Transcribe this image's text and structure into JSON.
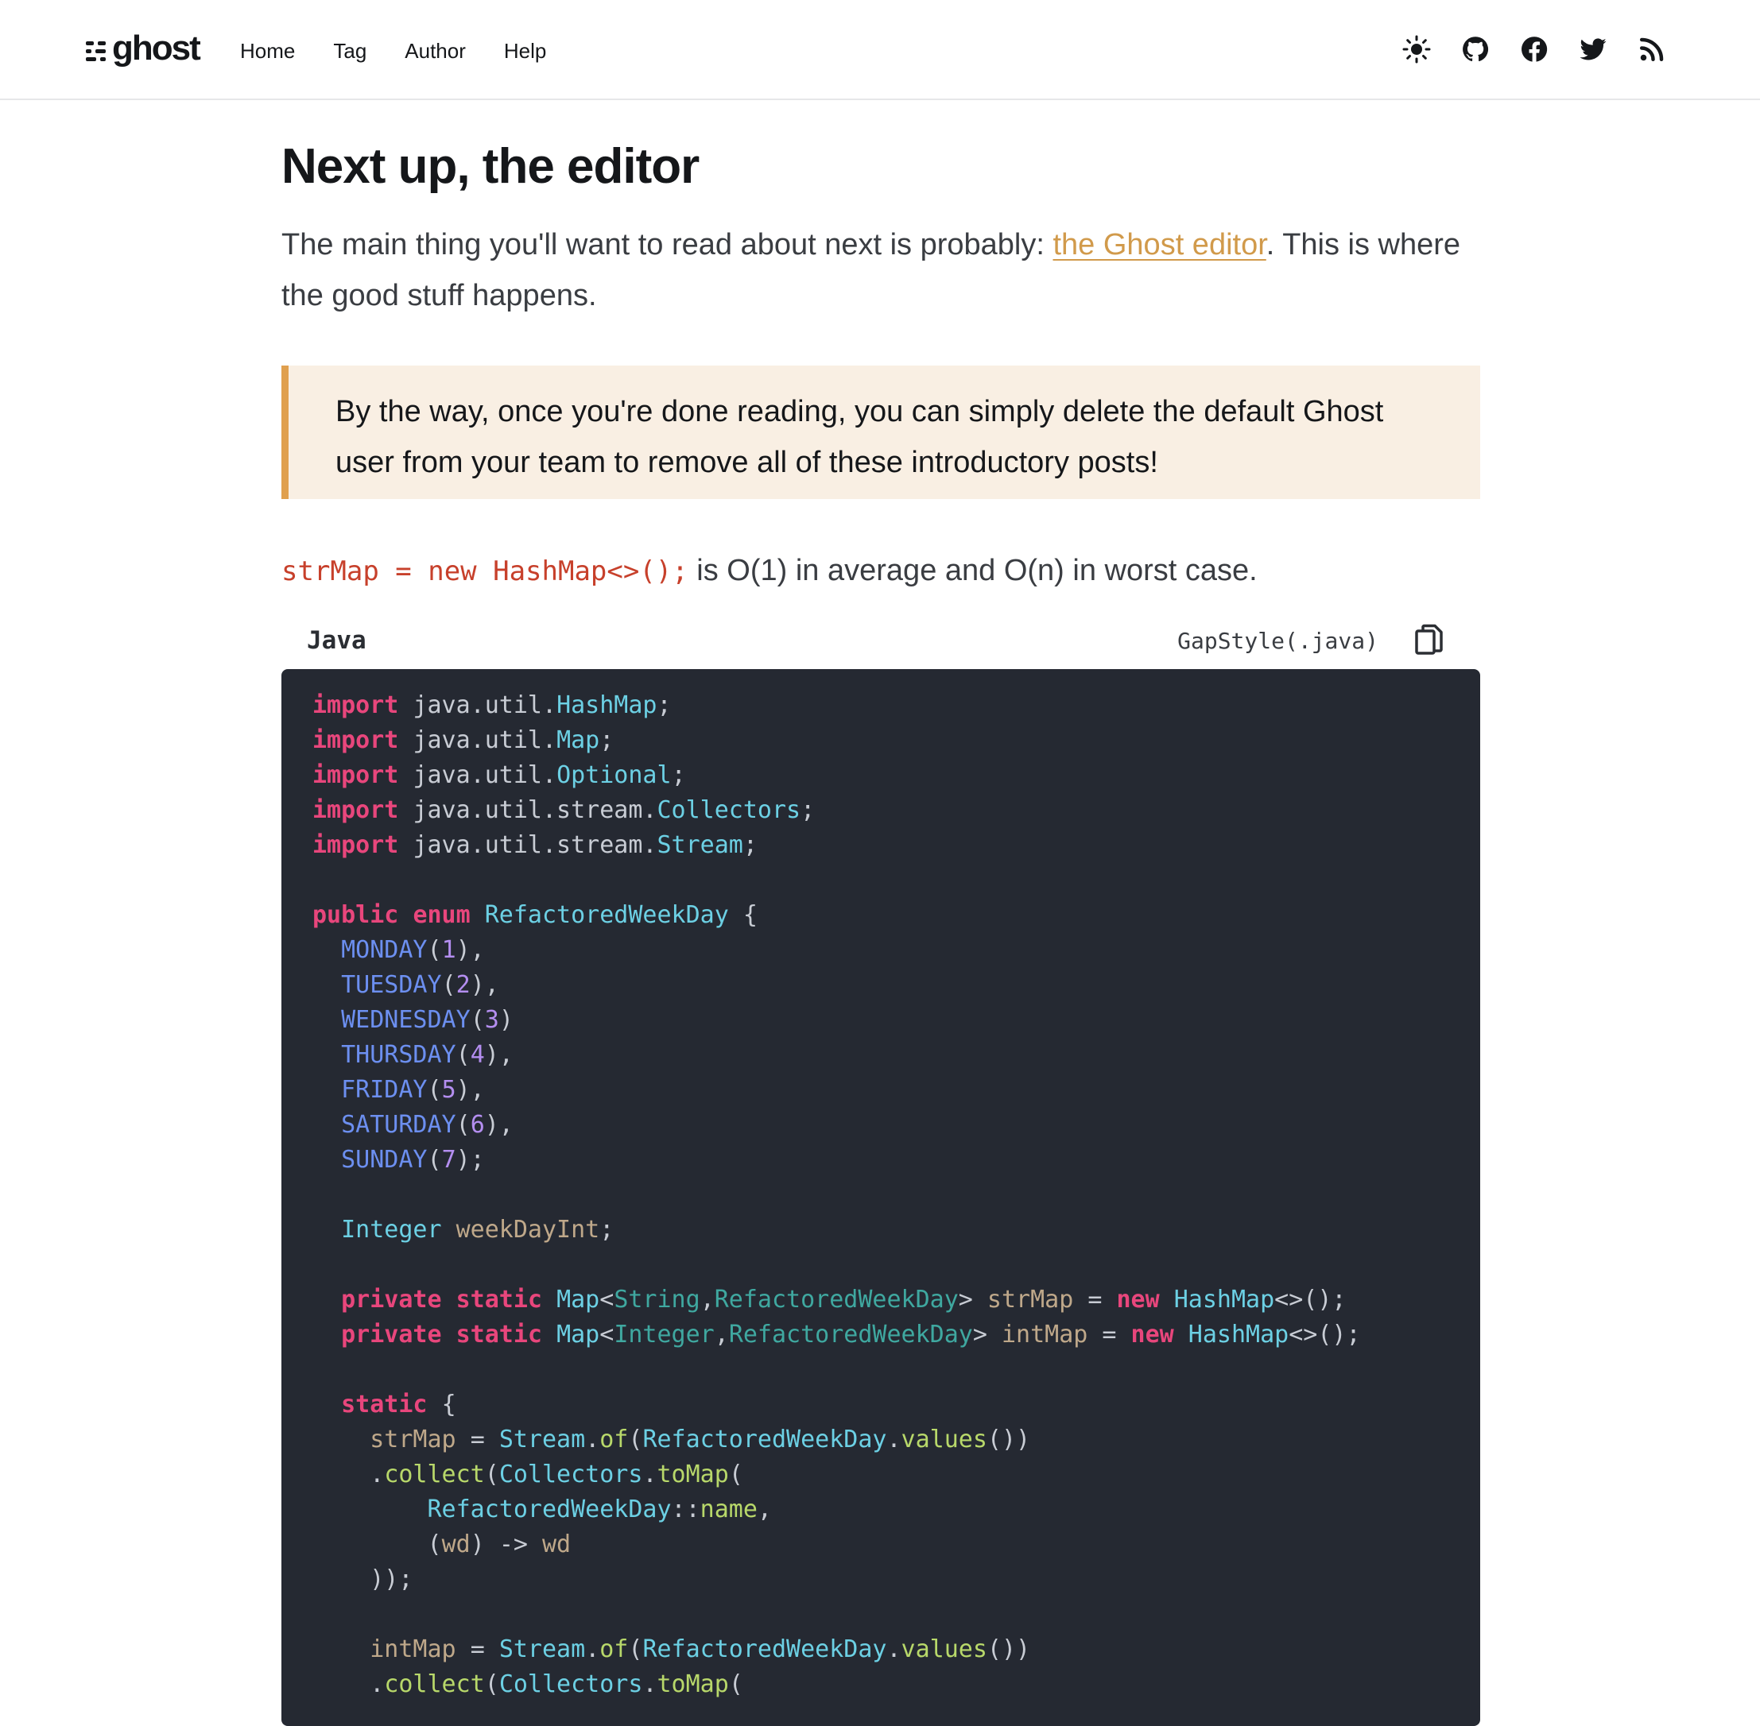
{
  "header": {
    "logo_text": "ghost",
    "nav": [
      "Home",
      "Tag",
      "Author",
      "Help"
    ],
    "icons": [
      "sun-icon",
      "github-icon",
      "facebook-icon",
      "twitter-icon",
      "rss-icon"
    ]
  },
  "article": {
    "heading": "Next up, the editor",
    "intro_before": "The main thing you'll want to read about next is probably: ",
    "intro_link": "the Ghost editor",
    "intro_after": ". This is where the good stuff happens.",
    "callout": "By the way, once you're done reading, you can simply delete the default Ghost user from your team to remove all of these introductory posts!",
    "inline_code": "strMap = new HashMap<>();",
    "inline_text": " is O(1) in average and O(n) in worst case."
  },
  "code": {
    "language": "Java",
    "filename": "GapStyle(.java)",
    "lines": [
      "import java.util.HashMap;",
      "import java.util.Map;",
      "import java.util.Optional;",
      "import java.util.stream.Collectors;",
      "import java.util.stream.Stream;",
      "",
      "public enum RefactoredWeekDay {",
      "  MONDAY(1),",
      "  TUESDAY(2),",
      "  WEDNESDAY(3)",
      "  THURSDAY(4),",
      "  FRIDAY(5),",
      "  SATURDAY(6),",
      "  SUNDAY(7);",
      "",
      "  Integer weekDayInt;",
      "",
      "  private static Map<String,RefactoredWeekDay> strMap = new HashMap<>();",
      "  private static Map<Integer,RefactoredWeekDay> intMap = new HashMap<>();",
      "",
      "  static {",
      "    strMap = Stream.of(RefactoredWeekDay.values())",
      "    .collect(Collectors.toMap(",
      "        RefactoredWeekDay::name,",
      "        (wd) -> wd",
      "    ));",
      "",
      "    intMap = Stream.of(RefactoredWeekDay.values())",
      "    .collect(Collectors.toMap("
    ]
  },
  "colors": {
    "accent": "#d19a4b",
    "callout_bg": "#f9efe3",
    "callout_border": "#e0a04e",
    "code_bg": "#252932",
    "inline_code": "#c7402b"
  }
}
